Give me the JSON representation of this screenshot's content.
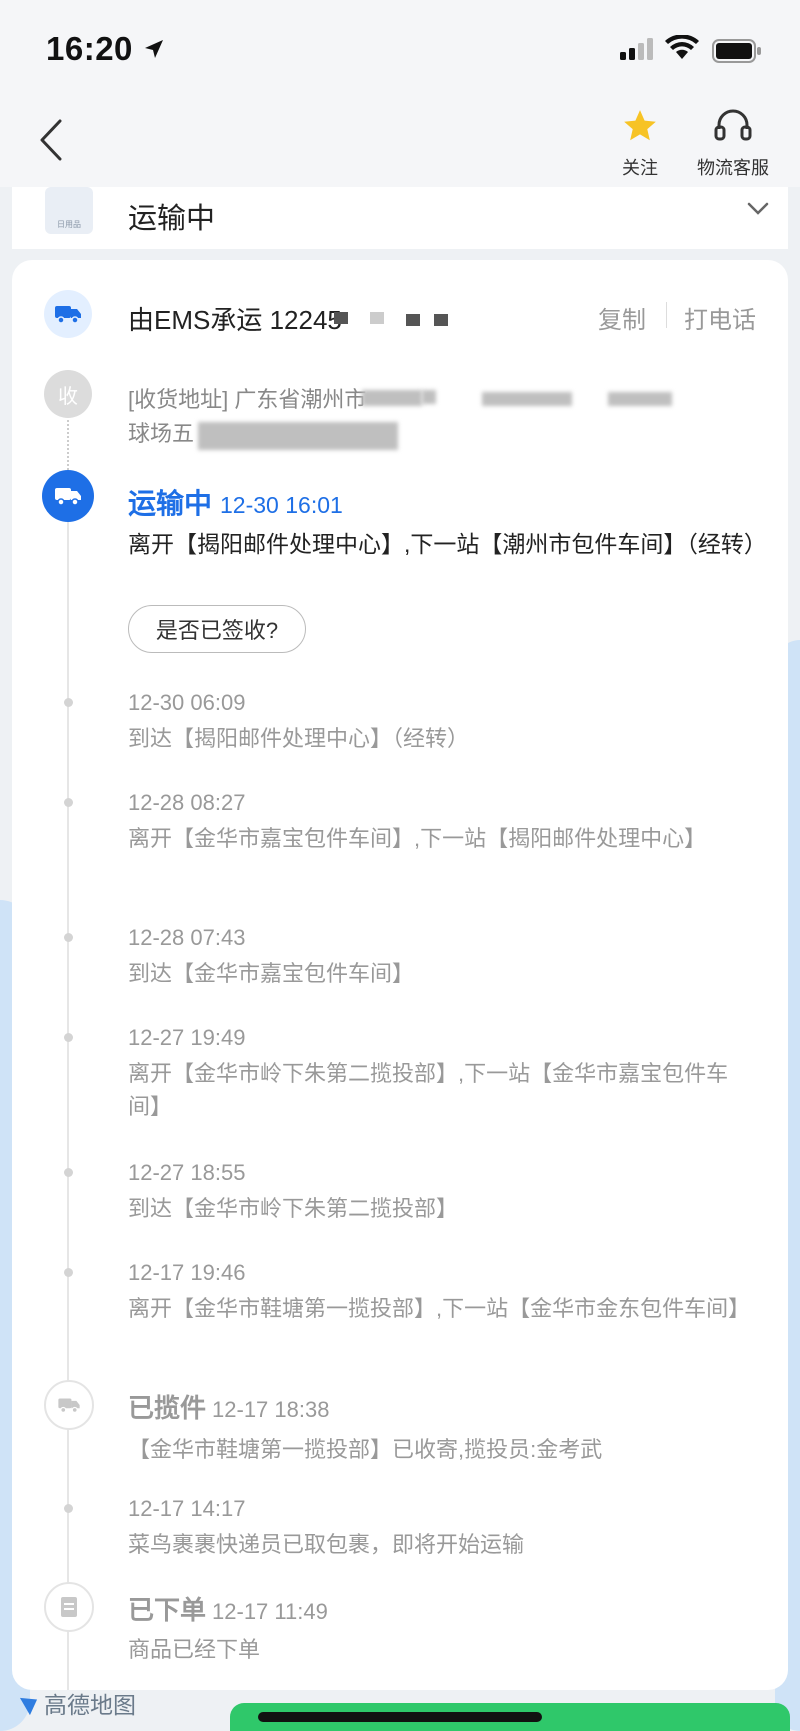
{
  "status_bar": {
    "time": "16:20"
  },
  "nav": {
    "follow_label": "关注",
    "service_label": "物流客服"
  },
  "stage": {
    "title": "运输中",
    "thumb_label": "日用品"
  },
  "carrier": {
    "text": "由EMS承运 12245",
    "copy_label": "复制",
    "call_label": "打电话"
  },
  "address": {
    "badge": "收",
    "line1": "[收货地址] 广东省潮州市",
    "line2": "球场五"
  },
  "current": {
    "status": "运输中",
    "time": "12-30 16:01",
    "desc": "离开【揭阳邮件处理中心】,下一站【潮州市包件车间】（经转）",
    "sign_button": "是否已签收?"
  },
  "events": [
    {
      "time": "12-30 06:09",
      "desc": "到达【揭阳邮件处理中心】（经转）"
    },
    {
      "time": "12-28 08:27",
      "desc": "离开【金华市嘉宝包件车间】,下一站【揭阳邮件处理中心】"
    },
    {
      "time": "12-28 07:43",
      "desc": "到达【金华市嘉宝包件车间】"
    },
    {
      "time": "12-27 19:49",
      "desc": "离开【金华市岭下朱第二揽投部】,下一站【金华市嘉宝包件车间】"
    },
    {
      "time": "12-27 18:55",
      "desc": "到达【金华市岭下朱第二揽投部】"
    },
    {
      "time": "12-17 19:46",
      "desc": "离开【金华市鞋塘第一揽投部】,下一站【金华市金东包件车间】"
    }
  ],
  "milestone_pickup": {
    "title": "已揽件",
    "time": "12-17 18:38",
    "desc": "【金华市鞋塘第一揽投部】已收寄,揽投员:金考武"
  },
  "event_courier": {
    "time": "12-17 14:17",
    "desc": "菜鸟裹裹快递员已取包裹，即将开始运输"
  },
  "milestone_order": {
    "title": "已下单",
    "time": "12-17 11:49",
    "desc": "商品已经下单"
  },
  "map": {
    "logo_text": "高德地图"
  },
  "colors": {
    "accent": "#1e6fe6",
    "star": "#f7c325"
  }
}
